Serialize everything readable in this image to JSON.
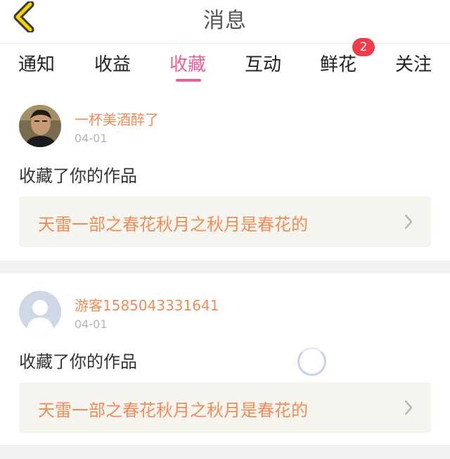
{
  "header": {
    "title": "消息",
    "back_icon": "chevron-left-icon",
    "accent_color": "#f3d400"
  },
  "tabs": [
    {
      "label": "通知",
      "active": false
    },
    {
      "label": "收益",
      "active": false
    },
    {
      "label": "收藏",
      "active": true
    },
    {
      "label": "互动",
      "active": false
    },
    {
      "label": "鲜花",
      "active": false,
      "badge": "2"
    },
    {
      "label": "关注",
      "active": false
    }
  ],
  "colors": {
    "active_tab": "#e8609b",
    "username": "#ef8c5a",
    "badge": "#f03b4d",
    "card_bg": "#f5f4ef"
  },
  "messages": [
    {
      "username": "一杯美酒醉了",
      "date": "04-01",
      "action": "收藏了你的作品",
      "work_title": "天雷一部之春花秋月之秋月是春花的",
      "avatar": "user-photo"
    },
    {
      "username": "游客1585043331641",
      "date": "04-01",
      "action": "收藏了你的作品",
      "work_title": "天雷一部之春花秋月之秋月是春花的",
      "avatar": "default-user-icon"
    }
  ]
}
